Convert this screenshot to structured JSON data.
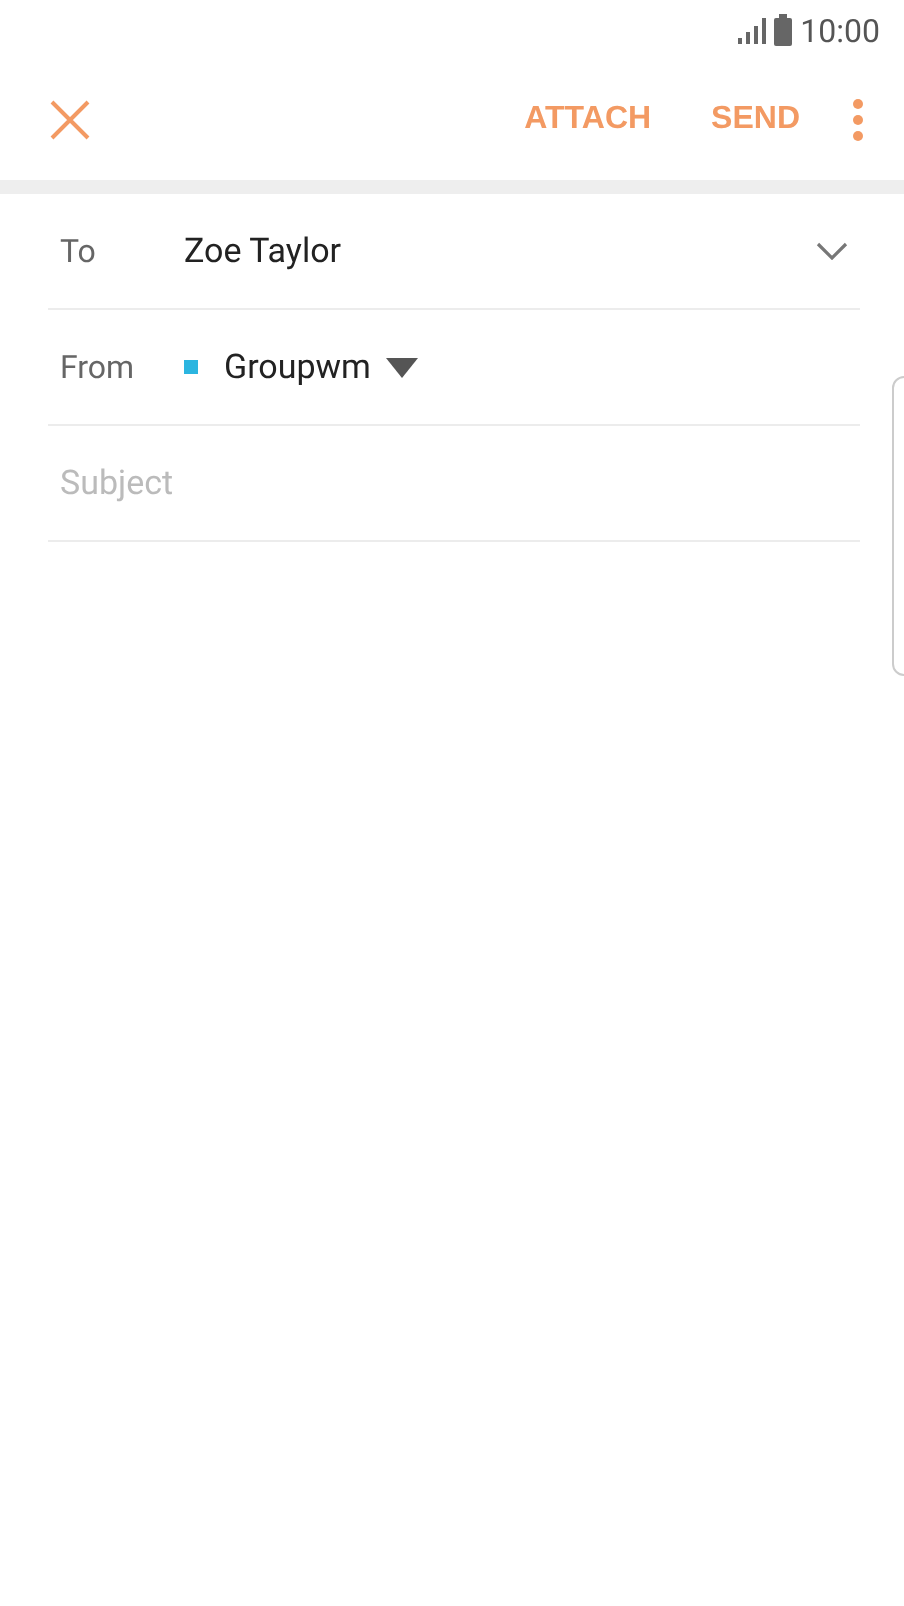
{
  "status_bar": {
    "time": "10:00"
  },
  "toolbar": {
    "actions": [
      "ATTACH",
      "SEND"
    ]
  },
  "to": {
    "label": "To",
    "value": "Zoe Taylor"
  },
  "from": {
    "label": "From",
    "account": "Groupwm",
    "color": "#2bb5e0"
  },
  "subject": {
    "placeholder": "Subject"
  }
}
